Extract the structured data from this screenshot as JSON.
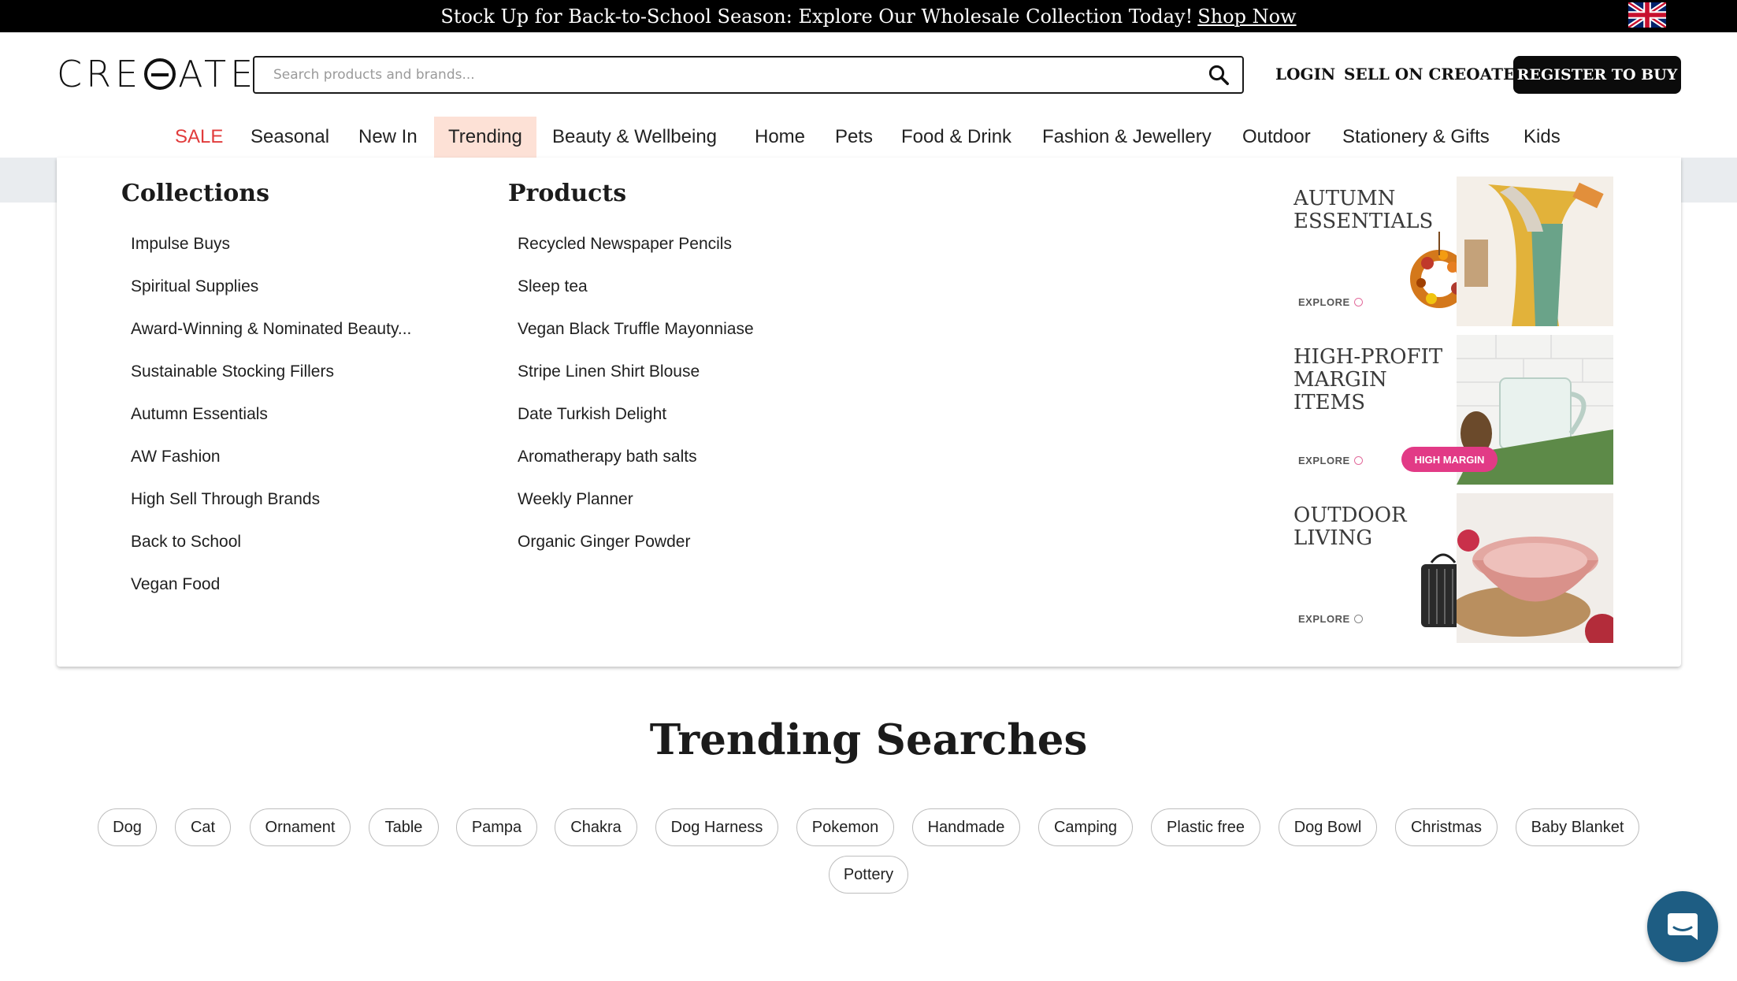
{
  "announcement": {
    "text": "Stock Up for Back-to-School Season: Explore Our Wholesale Collection Today!",
    "link": "Shop Now"
  },
  "flag": "uk-flag-icon",
  "header": {
    "logo_left": "CRE",
    "logo_right": "ATE",
    "search_placeholder": "Search products and brands...",
    "login": "LOGIN",
    "sell": "SELL ON CREOATE",
    "register": "REGISTER TO BUY"
  },
  "nav": [
    "SALE",
    "Seasonal",
    "New In",
    "Trending",
    "Beauty & Wellbeing",
    "Home",
    "Pets",
    "Food & Drink",
    "Fashion & Jewellery",
    "Outdoor",
    "Stationery & Gifts",
    "Kids"
  ],
  "nav_active": "Trending",
  "mega": {
    "collections_title": "Collections",
    "collections": [
      "Impulse Buys",
      "Spiritual Supplies",
      "Award-Winning & Nominated Beauty...",
      "Sustainable Stocking Fillers",
      "Autumn Essentials",
      "AW Fashion",
      "High Sell Through Brands",
      "Back to School",
      "Vegan Food"
    ],
    "products_title": "Products",
    "products": [
      "Recycled Newspaper Pencils",
      "Sleep tea",
      "Vegan Black Truffle Mayonniase",
      "Stripe Linen Shirt Blouse",
      "Date Turkish Delight",
      "Aromatherapy bath salts",
      "Weekly Planner",
      "Organic Ginger Powder"
    ],
    "promos": [
      {
        "title_lines": [
          "AUTUMN",
          "ESSENTIALS"
        ],
        "explore": "EXPLORE"
      },
      {
        "title_lines": [
          "HIGH-PROFIT",
          "MARGIN",
          "ITEMS"
        ],
        "explore": "EXPLORE",
        "badge": "HIGH MARGIN"
      },
      {
        "title_lines": [
          "OUTDOOR",
          "LIVING"
        ],
        "explore": "EXPLORE"
      }
    ]
  },
  "trending": {
    "title": "Trending Searches",
    "chips": [
      "Dog",
      "Cat",
      "Ornament",
      "Table",
      "Pampa",
      "Chakra",
      "Dog Harness",
      "Pokemon",
      "Handmade",
      "Camping",
      "Plastic free",
      "Dog Bowl",
      "Christmas",
      "Baby Blanket",
      "Pottery"
    ]
  },
  "colors": {
    "sale": "#e13b3b",
    "active_tab_bg": "#fde1d6",
    "badge": "#e23a86",
    "chat": "#1e5d83"
  }
}
